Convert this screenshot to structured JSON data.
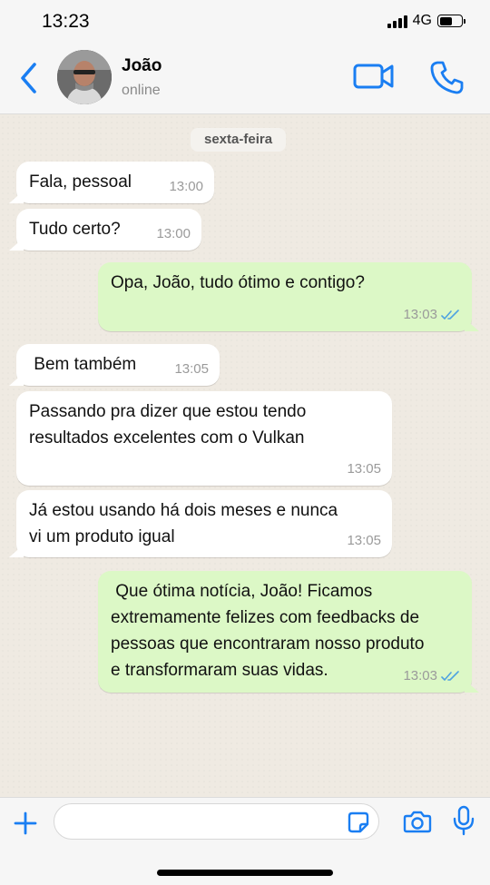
{
  "status_bar": {
    "time": "13:23",
    "network": "4G",
    "signal_level": 4,
    "battery_level": 0.6
  },
  "header": {
    "contact_name": "João",
    "contact_status": "online",
    "accent_color": "#1a7ef2",
    "icons": {
      "back": "chevron-left-icon",
      "video": "video-camera-icon",
      "call": "phone-icon"
    }
  },
  "chat": {
    "day_label": "sexta-feira",
    "messages": [
      {
        "direction": "incoming",
        "text": "Fala, pessoal",
        "time": "13:00"
      },
      {
        "direction": "incoming",
        "text": "Tudo certo?",
        "time": "13:00"
      },
      {
        "direction": "outgoing",
        "text": "Opa, João, tudo ótimo e contigo?",
        "time": "13:03",
        "status": "read"
      },
      {
        "direction": "incoming",
        "text": " Bem também",
        "time": "13:05"
      },
      {
        "direction": "incoming",
        "text": "Passando pra dizer que estou tendo\nresultados excelentes com o Vulkan",
        "time": "13:05"
      },
      {
        "direction": "incoming",
        "text": "Já estou usando há dois meses e nunca\nvi um produto igual",
        "time": "13:05"
      },
      {
        "direction": "outgoing",
        "text": " Que ótima notícia, João! Ficamos\nextremamente felizes com feedbacks de\npessoas que encontraram nosso produto\ne transformaram suas vidas.",
        "time": "13:03",
        "status": "read"
      }
    ],
    "colors": {
      "incoming_bubble": "#ffffff",
      "outgoing_bubble": "#dcf8c6",
      "read_ticks": "#4fa3e0"
    }
  },
  "input_bar": {
    "placeholder": "",
    "value": "",
    "icons": {
      "plus": "plus-icon",
      "sticker": "sticker-icon",
      "camera": "camera-icon",
      "mic": "microphone-icon"
    }
  }
}
